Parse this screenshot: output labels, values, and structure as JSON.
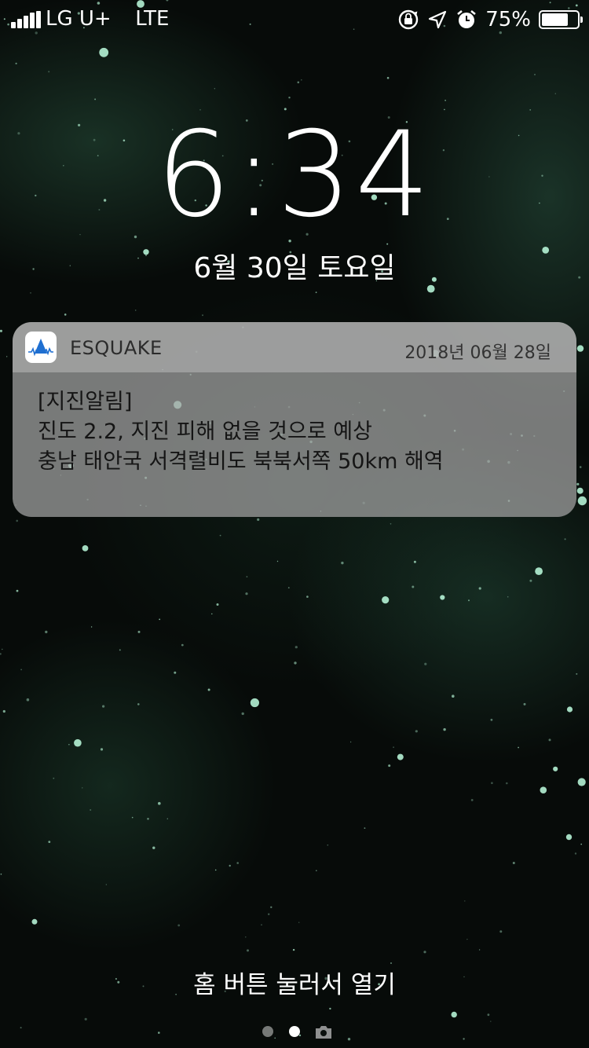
{
  "status_bar": {
    "carrier": "LG U+",
    "network": "LTE",
    "battery_percent": "75%",
    "battery_level": 0.75,
    "icons": [
      "signal-icon",
      "orientation-lock-icon",
      "location-icon",
      "alarm-icon",
      "battery-icon"
    ]
  },
  "lock_screen": {
    "time": "6:34",
    "date": "6월 30일 토요일",
    "unlock_hint": "홈 버튼 눌러서 열기"
  },
  "notification": {
    "app_name": "ESQUAKE",
    "timestamp": "2018년 06월 28일",
    "title": "[지진알림]",
    "lines": [
      "진도 2.2, 지진 피해 없을 것으로 예상",
      "충남 태안국 서격렬비도 북북서쪽 50km 해역"
    ]
  },
  "page_indicator": {
    "pages": [
      "dot",
      "dot-active",
      "camera-icon"
    ],
    "current": 2
  },
  "colors": {
    "background": "#070b09",
    "notification_bg": "#a5a5a5",
    "app_icon_accent": "#1f6fd1"
  }
}
